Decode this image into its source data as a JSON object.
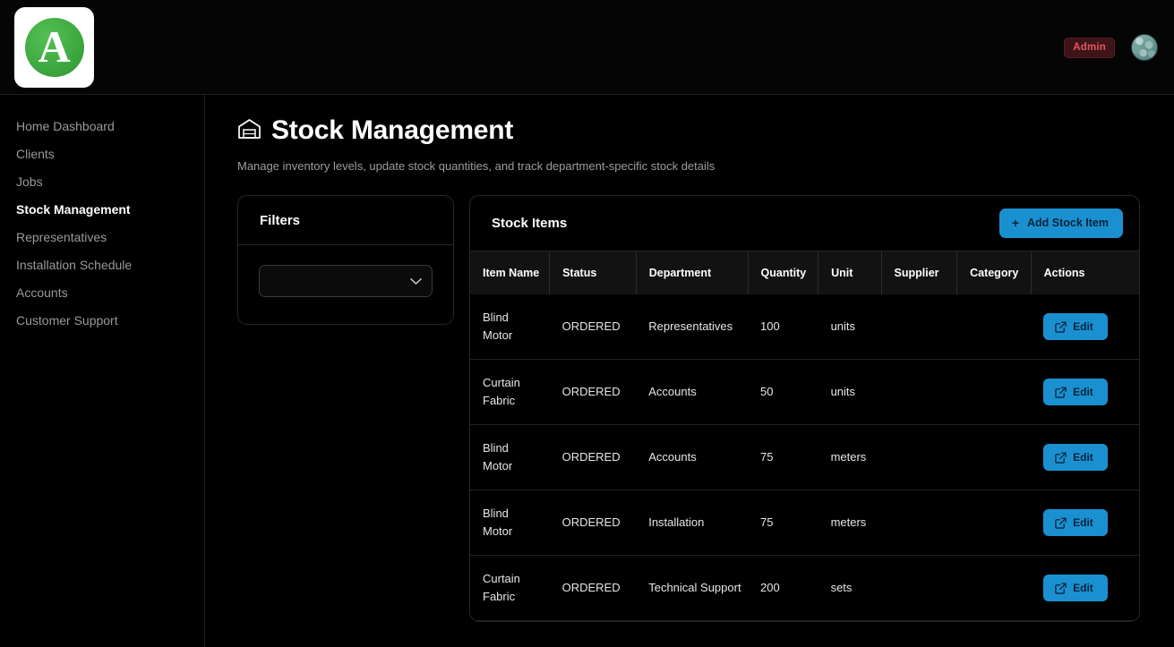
{
  "header": {
    "logo_letter": "A",
    "logo_icon": "letter-a-logo",
    "admin_badge": "Admin",
    "avatar_icon": "user-avatar",
    "accent_blue": "#1b90d0",
    "badge_bg": "#3d1418",
    "badge_text_color": "#e3555f"
  },
  "sidebar": {
    "items": [
      {
        "label": "Home Dashboard",
        "active": false
      },
      {
        "label": "Clients",
        "active": false
      },
      {
        "label": "Jobs",
        "active": false
      },
      {
        "label": "Stock Management",
        "active": true
      },
      {
        "label": "Representatives",
        "active": false
      },
      {
        "label": "Installation Schedule",
        "active": false
      },
      {
        "label": "Accounts",
        "active": false
      },
      {
        "label": "Customer Support",
        "active": false
      }
    ]
  },
  "page": {
    "icon": "warehouse-icon",
    "title": "Stock Management",
    "subtitle": "Manage inventory levels, update stock quantities, and track department-specific stock details"
  },
  "filters": {
    "title": "Filters",
    "select": {
      "value": "",
      "placeholder": "",
      "icon": "chevron-down-icon"
    }
  },
  "stock": {
    "title": "Stock Items",
    "add_button": {
      "label": "Add Stock Item",
      "icon": "plus-icon"
    },
    "columns": [
      "Item Name",
      "Status",
      "Department",
      "Quantity",
      "Unit",
      "Supplier",
      "Category",
      "Actions"
    ],
    "action_label": "Edit",
    "action_icon": "edit-square-icon",
    "rows": [
      {
        "item_name": "Blind Motor",
        "status": "ORDERED",
        "department": "Representatives",
        "quantity": "100",
        "unit": "units",
        "supplier": "",
        "category": ""
      },
      {
        "item_name": "Curtain Fabric",
        "status": "ORDERED",
        "department": "Accounts",
        "quantity": "50",
        "unit": "units",
        "supplier": "",
        "category": ""
      },
      {
        "item_name": "Blind Motor",
        "status": "ORDERED",
        "department": "Accounts",
        "quantity": "75",
        "unit": "meters",
        "supplier": "",
        "category": ""
      },
      {
        "item_name": "Blind Motor",
        "status": "ORDERED",
        "department": "Installation",
        "quantity": "75",
        "unit": "meters",
        "supplier": "",
        "category": ""
      },
      {
        "item_name": "Curtain Fabric",
        "status": "ORDERED",
        "department": "Technical Support",
        "quantity": "200",
        "unit": "sets",
        "supplier": "",
        "category": ""
      }
    ]
  }
}
